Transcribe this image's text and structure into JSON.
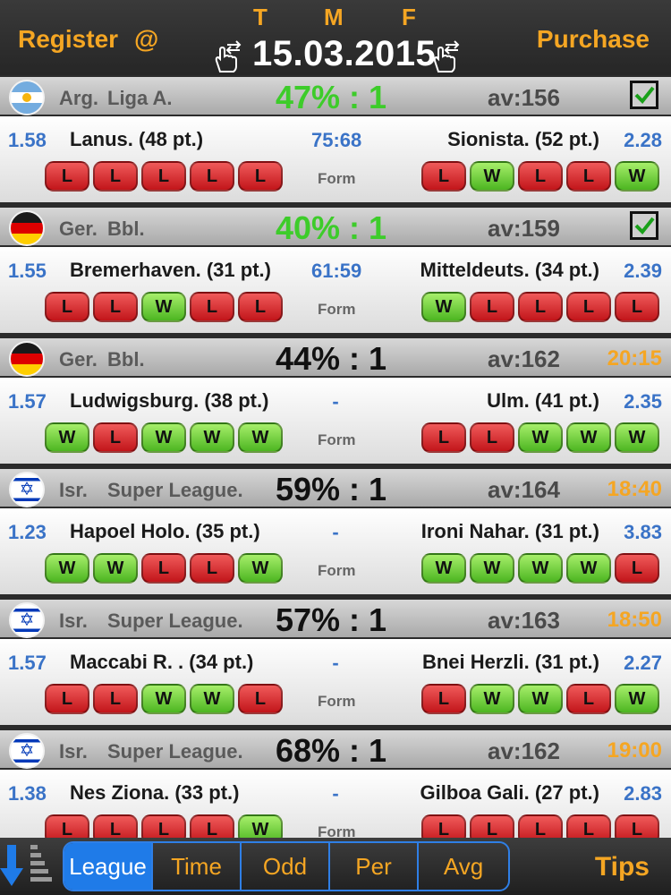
{
  "header": {
    "register_label": "Register",
    "at_label": "@",
    "purchase_label": "Purchase",
    "tmf": [
      "T",
      "M",
      "F"
    ],
    "date": "15.03.2015"
  },
  "form_label": "Form",
  "colors": {
    "accent": "#f5a623",
    "win": "#4cb521",
    "loss": "#c2151a",
    "odd": "#3a73c7",
    "percent_hit": "#3dcc2a"
  },
  "matches": [
    {
      "flag": "argentina-flag",
      "country": "Arg.",
      "league": "Liga A.",
      "percent": "47% : 1",
      "percent_green": true,
      "avg": "av:156",
      "time": "",
      "checked": true,
      "home": {
        "odd": "1.58",
        "team": "Lanus. (48 pt.)",
        "form": [
          "L",
          "L",
          "L",
          "L",
          "L"
        ]
      },
      "score": "75:68",
      "away": {
        "odd": "2.28",
        "team": "Sionista. (52 pt.)",
        "form": [
          "L",
          "W",
          "L",
          "L",
          "W"
        ]
      }
    },
    {
      "flag": "germany-flag",
      "country": "Ger.",
      "league": "Bbl.",
      "percent": "40% : 1",
      "percent_green": true,
      "avg": "av:159",
      "time": "",
      "checked": true,
      "home": {
        "odd": "1.55",
        "team": "Bremerhaven. (31 pt.)",
        "form": [
          "L",
          "L",
          "W",
          "L",
          "L"
        ]
      },
      "score": "61:59",
      "away": {
        "odd": "2.39",
        "team": "Mitteldeuts. (34 pt.)",
        "form": [
          "W",
          "L",
          "L",
          "L",
          "L"
        ]
      }
    },
    {
      "flag": "germany-flag",
      "country": "Ger.",
      "league": "Bbl.",
      "percent": "44% : 1",
      "percent_green": false,
      "avg": "av:162",
      "time": "20:15",
      "checked": false,
      "home": {
        "odd": "1.57",
        "team": "Ludwigsburg. (38 pt.)",
        "form": [
          "W",
          "L",
          "W",
          "W",
          "W"
        ]
      },
      "score": "-",
      "away": {
        "odd": "2.35",
        "team": "Ulm. (41 pt.)",
        "form": [
          "L",
          "L",
          "W",
          "W",
          "W"
        ]
      }
    },
    {
      "flag": "israel-flag",
      "country": "Isr.",
      "league": "Super League.",
      "percent": "59% : 1",
      "percent_green": false,
      "avg": "av:164",
      "time": "18:40",
      "checked": false,
      "home": {
        "odd": "1.23",
        "team": "Hapoel Holo. (35 pt.)",
        "form": [
          "W",
          "W",
          "L",
          "L",
          "W"
        ]
      },
      "score": "-",
      "away": {
        "odd": "3.83",
        "team": "Ironi Nahar. (31 pt.)",
        "form": [
          "W",
          "W",
          "W",
          "W",
          "L"
        ]
      }
    },
    {
      "flag": "israel-flag",
      "country": "Isr.",
      "league": "Super League.",
      "percent": "57% : 1",
      "percent_green": false,
      "avg": "av:163",
      "time": "18:50",
      "checked": false,
      "home": {
        "odd": "1.57",
        "team": "Maccabi R. . (34 pt.)",
        "form": [
          "L",
          "L",
          "W",
          "W",
          "L"
        ]
      },
      "score": "-",
      "away": {
        "odd": "2.27",
        "team": "Bnei Herzli. (31 pt.)",
        "form": [
          "L",
          "W",
          "W",
          "L",
          "W"
        ]
      }
    },
    {
      "flag": "israel-flag",
      "country": "Isr.",
      "league": "Super League.",
      "percent": "68% : 1",
      "percent_green": false,
      "avg": "av:162",
      "time": "19:00",
      "checked": false,
      "home": {
        "odd": "1.38",
        "team": "Nes Ziona. (33 pt.)",
        "form": [
          "L",
          "L",
          "L",
          "L",
          "W"
        ]
      },
      "score": "-",
      "away": {
        "odd": "2.83",
        "team": "Gilboa Gali. (27 pt.)",
        "form": [
          "L",
          "L",
          "L",
          "L",
          "L"
        ]
      }
    }
  ],
  "bottom": {
    "tabs": [
      "League",
      "Time",
      "Odd",
      "Per",
      "Avg"
    ],
    "active_tab": "League",
    "tips_label": "Tips"
  }
}
